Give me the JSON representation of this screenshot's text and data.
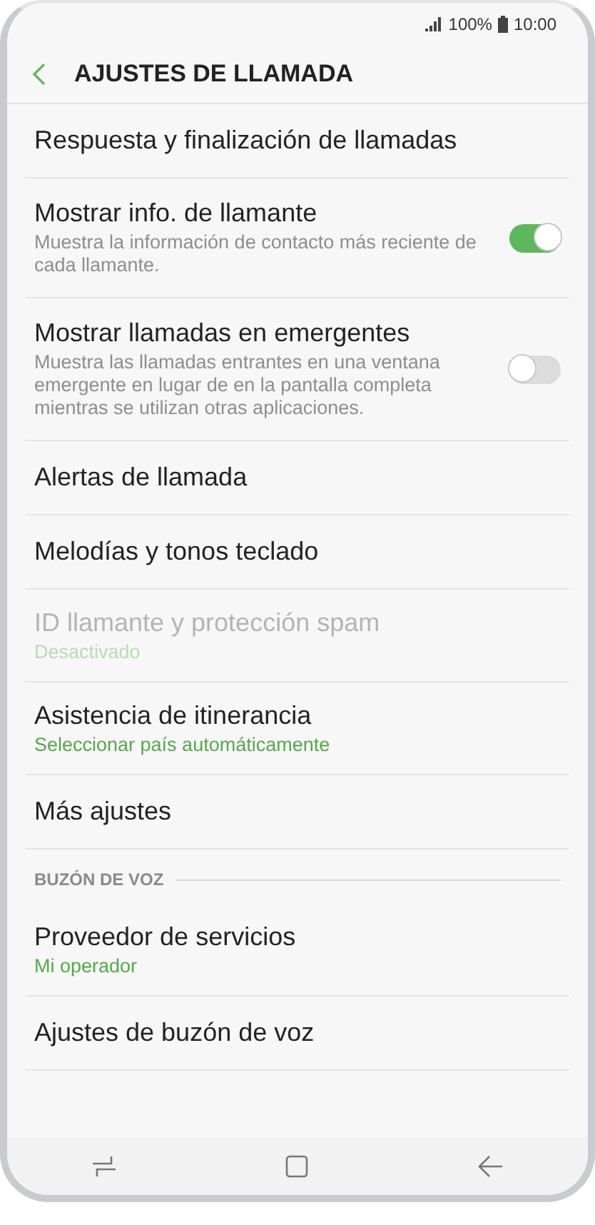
{
  "status_bar": {
    "battery": "100%",
    "time": "10:00"
  },
  "header": {
    "title": "AJUSTES DE LLAMADA"
  },
  "items": [
    {
      "kind": "plain",
      "title": "Respuesta y finalización de llamadas",
      "disabled": false
    },
    {
      "kind": "toggle",
      "title": "Mostrar info. de llamante",
      "description": "Muestra la información de contacto más reciente de cada llamante.",
      "on": true
    },
    {
      "kind": "toggle",
      "title": "Mostrar llamadas en emergentes",
      "description": "Muestra las llamadas entrantes en una ventana emergente en lugar de en la pantalla completa mientras se utilizan otras aplicaciones.",
      "on": false
    },
    {
      "kind": "plain",
      "title": "Alertas de llamada",
      "disabled": false
    },
    {
      "kind": "plain",
      "title": "Melodías y tonos teclado",
      "disabled": false
    },
    {
      "kind": "plain",
      "title": "ID llamante y protección spam",
      "subtitle": "Desactivado",
      "disabled": true
    },
    {
      "kind": "plain",
      "title": "Asistencia de itinerancia",
      "subtitle": "Seleccionar país automáticamente",
      "disabled": false
    },
    {
      "kind": "plain",
      "title": "Más ajustes",
      "disabled": false
    },
    {
      "kind": "section",
      "title": "BUZÓN DE VOZ"
    },
    {
      "kind": "plain",
      "title": "Proveedor de servicios",
      "subtitle": "Mi operador",
      "disabled": false
    },
    {
      "kind": "plain",
      "title": "Ajustes de buzón de voz",
      "disabled": false
    }
  ]
}
